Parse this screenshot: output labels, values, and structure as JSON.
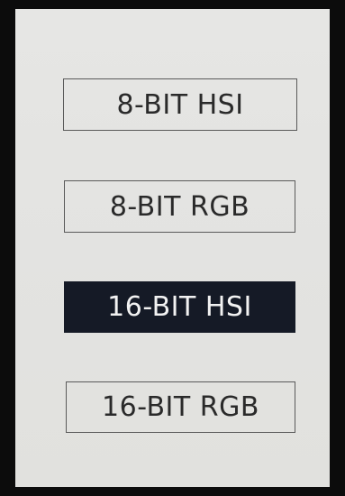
{
  "menu": {
    "options": [
      {
        "label": "8-BIT HSI",
        "selected": false
      },
      {
        "label": "8-BIT RGB",
        "selected": false
      },
      {
        "label": "16-BIT HSI",
        "selected": true
      },
      {
        "label": "16-BIT RGB",
        "selected": false
      }
    ]
  },
  "colors": {
    "bezel": "#0c0c0c",
    "screen": "#e4e4e2",
    "selected_fill": "#151a26",
    "selected_text": "#f2f2f2",
    "text": "#2a2a2a"
  }
}
